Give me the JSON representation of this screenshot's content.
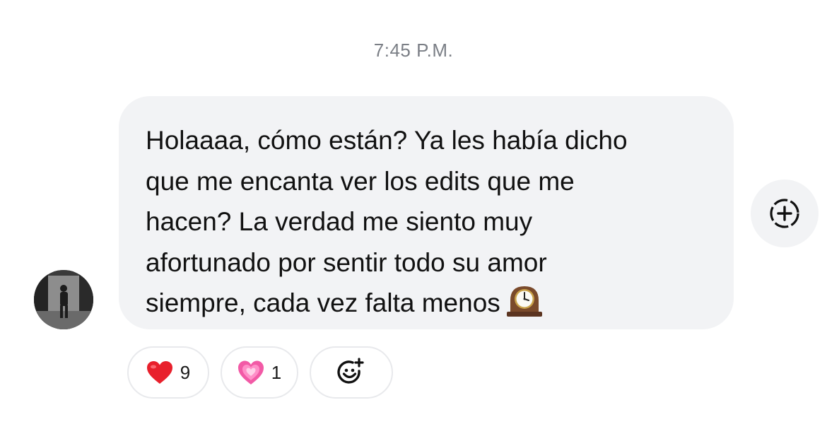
{
  "thread": {
    "timestamp": "7:45 P.M."
  },
  "message": {
    "text": "Holaaaa, cómo están? Ya les había dicho\nque me encanta ver los edits que me\nhacen? La verdad me siento muy\nafortunado por sentir todo su amor\nsiempre, cada vez falta menos",
    "trailing_emoji": "mantelpiece-clock-icon"
  },
  "reactions": [
    {
      "emoji": "red-heart-icon",
      "count": "9"
    },
    {
      "emoji": "growing-heart-icon",
      "count": "1"
    }
  ],
  "actions": {
    "add_reaction_icon": "add-emoji-icon",
    "side_react_icon": "add-reaction-circle-icon"
  },
  "colors": {
    "bubble_bg": "#f2f3f5",
    "timestamp": "#7b7f86",
    "heart_red": "#e8202c",
    "heart_pink": "#f25aa6"
  }
}
